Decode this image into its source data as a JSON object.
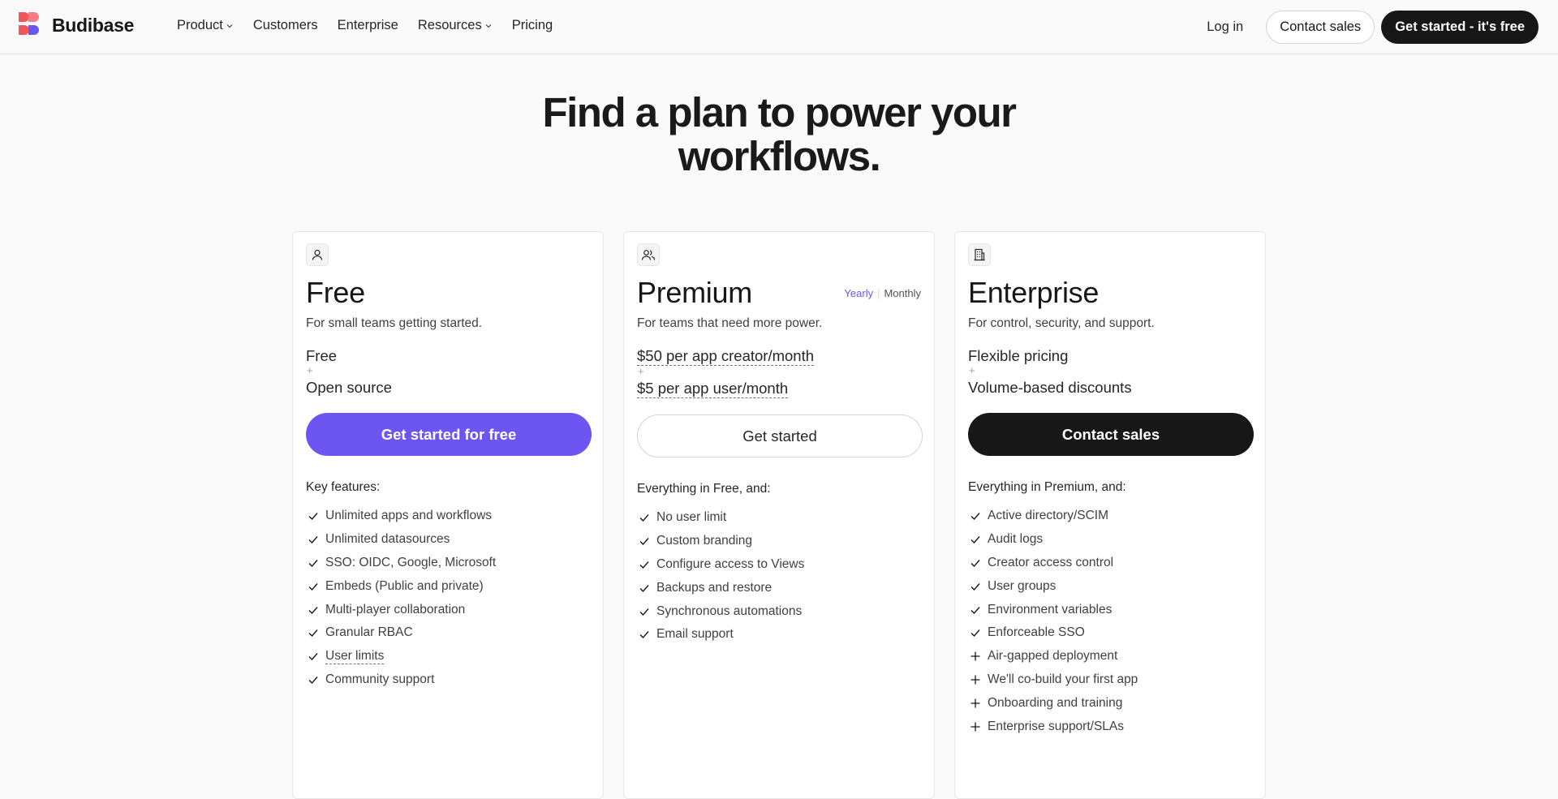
{
  "brand": {
    "name": "Budibase"
  },
  "nav": {
    "links": [
      {
        "label": "Product",
        "dropdown": true
      },
      {
        "label": "Customers",
        "dropdown": false
      },
      {
        "label": "Enterprise",
        "dropdown": false
      },
      {
        "label": "Resources",
        "dropdown": true
      },
      {
        "label": "Pricing",
        "dropdown": false
      }
    ],
    "login": "Log in",
    "contact_sales": "Contact sales",
    "get_started": "Get started - it's free"
  },
  "hero": {
    "title_line1": "Find a plan to power your",
    "title_line2": "workflows."
  },
  "plans": [
    {
      "name": "Free",
      "icon": "user-icon",
      "description": "For small teams getting started.",
      "price_line1": "Free",
      "price_line2": "Open source",
      "cta": "Get started for free",
      "features_heading": "Key features:",
      "features": [
        {
          "text": "Unlimited apps and workflows",
          "mark": "check"
        },
        {
          "text": "Unlimited datasources",
          "mark": "check"
        },
        {
          "text": "SSO: OIDC, Google, Microsoft",
          "mark": "check"
        },
        {
          "text": "Embeds (Public and private)",
          "mark": "check"
        },
        {
          "text": "Multi-player collaboration",
          "mark": "check"
        },
        {
          "text": "Granular RBAC",
          "mark": "check"
        },
        {
          "text": "User limits",
          "mark": "check",
          "dashed": true
        },
        {
          "text": "Community support",
          "mark": "check"
        }
      ]
    },
    {
      "name": "Premium",
      "icon": "users-icon",
      "description": "For teams that need more power.",
      "price_line1": "$50 per app creator/month",
      "price_line2": "$5 per app user/month",
      "cta": "Get started",
      "billing_toggle": {
        "yearly": "Yearly",
        "monthly": "Monthly",
        "selected": "Yearly"
      },
      "features_heading": "Everything in Free, and:",
      "features": [
        {
          "text": "No user limit",
          "mark": "check"
        },
        {
          "text": "Custom branding",
          "mark": "check"
        },
        {
          "text": "Configure access to Views",
          "mark": "check"
        },
        {
          "text": "Backups and restore",
          "mark": "check"
        },
        {
          "text": "Synchronous automations",
          "mark": "check"
        },
        {
          "text": "Email support",
          "mark": "check"
        }
      ]
    },
    {
      "name": "Enterprise",
      "icon": "building-icon",
      "description": "For control, security, and support.",
      "price_line1": "Flexible pricing",
      "price_line2": "Volume-based discounts",
      "cta": "Contact sales",
      "features_heading": "Everything in Premium, and:",
      "features": [
        {
          "text": "Active directory/SCIM",
          "mark": "check"
        },
        {
          "text": "Audit logs",
          "mark": "check"
        },
        {
          "text": "Creator access control",
          "mark": "check"
        },
        {
          "text": "User groups",
          "mark": "check"
        },
        {
          "text": "Environment variables",
          "mark": "check"
        },
        {
          "text": "Enforceable SSO",
          "mark": "check"
        },
        {
          "text": "Air-gapped deployment",
          "mark": "plus"
        },
        {
          "text": "We'll co-build your first app",
          "mark": "plus"
        },
        {
          "text": "Onboarding and training",
          "mark": "plus"
        },
        {
          "text": "Enterprise support/SLAs",
          "mark": "plus"
        }
      ]
    }
  ],
  "colors": {
    "accent": "#6d55f2",
    "dark": "#171717",
    "logo_red": "#f2545b",
    "logo_purple": "#6d55f2"
  }
}
